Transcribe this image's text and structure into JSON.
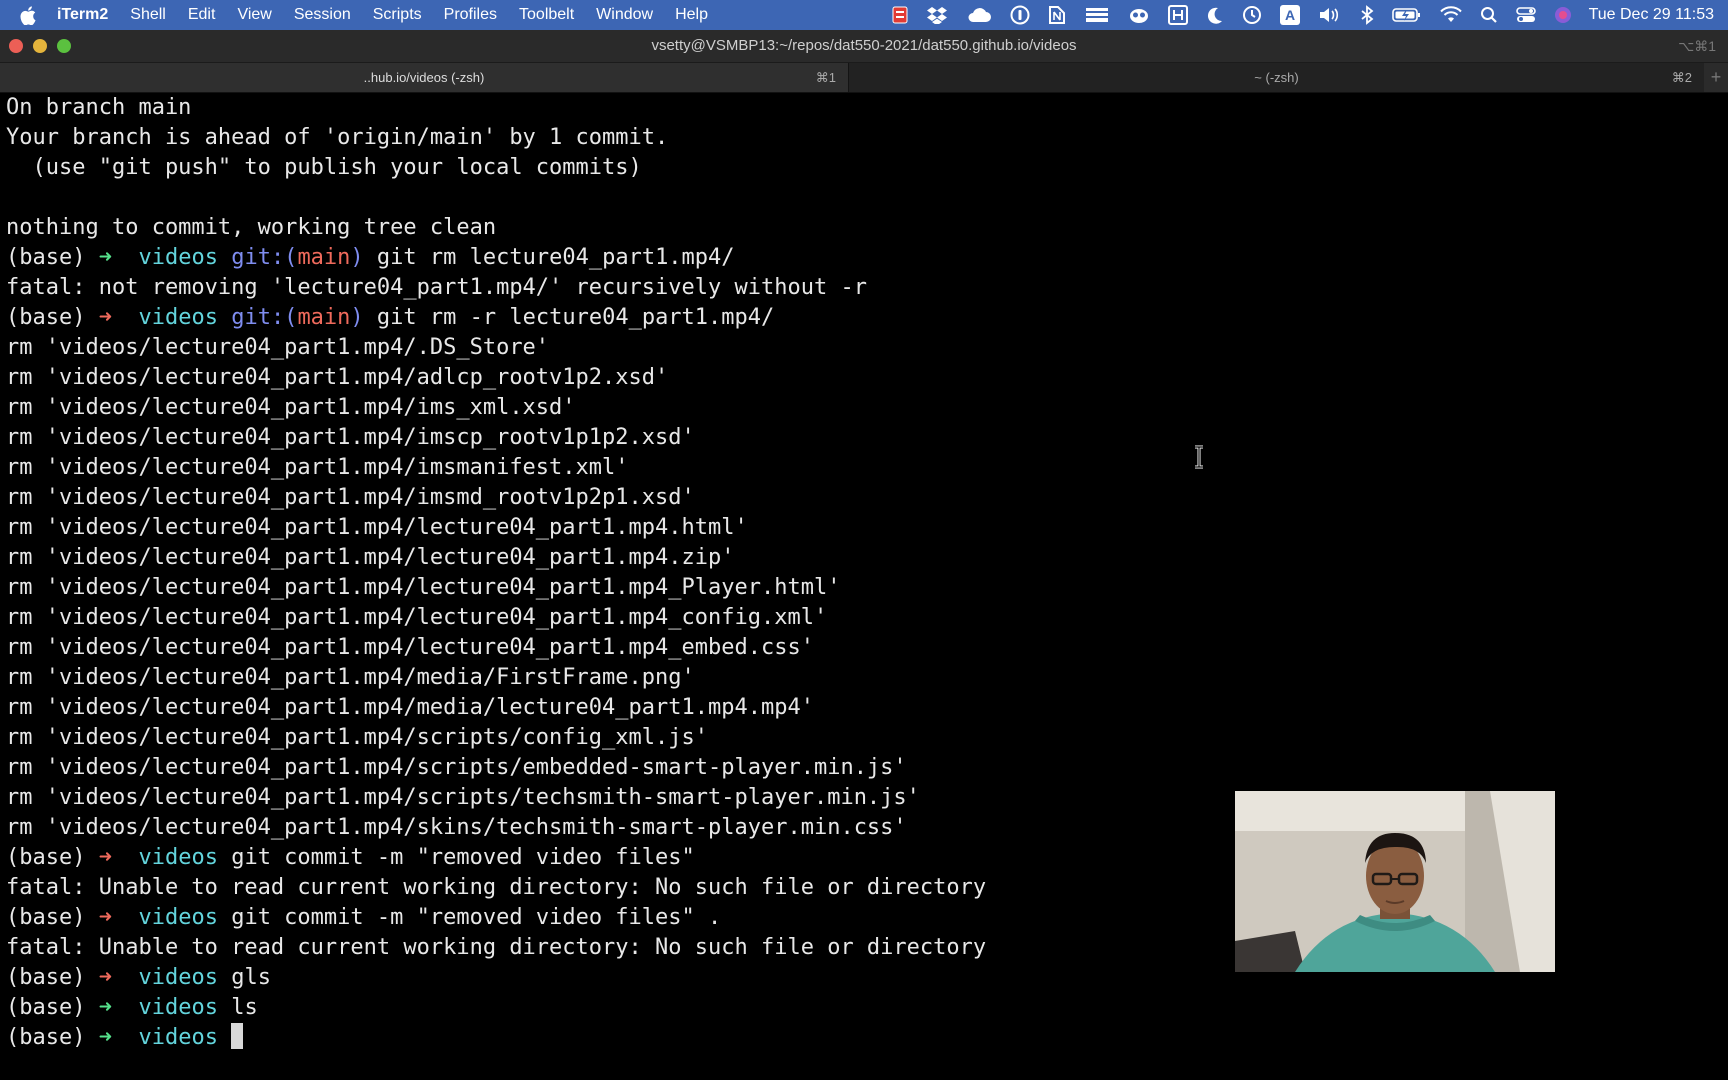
{
  "menubar": {
    "apple_icon": "apple-logo",
    "items": [
      "iTerm2",
      "Shell",
      "Edit",
      "View",
      "Session",
      "Scripts",
      "Profiles",
      "Toolbelt",
      "Window",
      "Help"
    ],
    "clock": "Tue Dec 29  11:53",
    "status_icons": [
      "recording-icon",
      "dropbox-icon",
      "cloud-icon",
      "onepassword-icon",
      "notion-icon",
      "stack-icon",
      "owl-icon",
      "keyboard-icon",
      "moon-icon",
      "time-machine-icon",
      "input-source-icon",
      "volume-icon",
      "bluetooth-icon",
      "battery-icon",
      "wifi-icon",
      "search-icon",
      "control-center-icon",
      "siri-icon"
    ],
    "input_source_label": "A",
    "colors": {
      "bar": "#3d66b4"
    }
  },
  "window": {
    "title": "vsetty@VSMBP13:~/repos/dat550-2021/dat550.github.io/videos",
    "shortcut": "⌥⌘1"
  },
  "tabs": [
    {
      "label": "..hub.io/videos (-zsh)",
      "shortcut": "⌘1"
    },
    {
      "label": "~ (-zsh)",
      "shortcut": "⌘2"
    }
  ],
  "new_tab_label": "+",
  "terminal": {
    "colors": {
      "cwd": "#63d4dc",
      "prompt_ok": "#55e08b",
      "prompt_err": "#ef6a5c",
      "git": "#7f8df0"
    },
    "lines": [
      [
        {
          "t": "On branch main"
        }
      ],
      [
        {
          "t": "Your branch is ahead of 'origin/main' by 1 commit."
        }
      ],
      [
        {
          "t": "  (use \"git push\" to publish your local commits)"
        }
      ],
      [
        {
          "t": ""
        }
      ],
      [
        {
          "t": "nothing to commit, working tree clean"
        }
      ],
      [
        {
          "t": "(base) "
        },
        {
          "t": "➜",
          "c": "green"
        },
        {
          "t": "  "
        },
        {
          "t": "videos",
          "c": "cyan"
        },
        {
          "t": " "
        },
        {
          "t": "git:(",
          "c": "blue"
        },
        {
          "t": "main",
          "c": "pink"
        },
        {
          "t": ")",
          "c": "blue"
        },
        {
          "t": " git rm lecture04_part1.mp4/"
        }
      ],
      [
        {
          "t": "fatal: not removing 'lecture04_part1.mp4/' recursively without -r"
        }
      ],
      [
        {
          "t": "(base) "
        },
        {
          "t": "➜",
          "c": "red"
        },
        {
          "t": "  "
        },
        {
          "t": "videos",
          "c": "cyan"
        },
        {
          "t": " "
        },
        {
          "t": "git:(",
          "c": "blue"
        },
        {
          "t": "main",
          "c": "pink"
        },
        {
          "t": ")",
          "c": "blue"
        },
        {
          "t": " git rm -r lecture04_part1.mp4/"
        }
      ],
      [
        {
          "t": "rm 'videos/lecture04_part1.mp4/.DS_Store'"
        }
      ],
      [
        {
          "t": "rm 'videos/lecture04_part1.mp4/adlcp_rootv1p2.xsd'"
        }
      ],
      [
        {
          "t": "rm 'videos/lecture04_part1.mp4/ims_xml.xsd'"
        }
      ],
      [
        {
          "t": "rm 'videos/lecture04_part1.mp4/imscp_rootv1p1p2.xsd'"
        }
      ],
      [
        {
          "t": "rm 'videos/lecture04_part1.mp4/imsmanifest.xml'"
        }
      ],
      [
        {
          "t": "rm 'videos/lecture04_part1.mp4/imsmd_rootv1p2p1.xsd'"
        }
      ],
      [
        {
          "t": "rm 'videos/lecture04_part1.mp4/lecture04_part1.mp4.html'"
        }
      ],
      [
        {
          "t": "rm 'videos/lecture04_part1.mp4/lecture04_part1.mp4.zip'"
        }
      ],
      [
        {
          "t": "rm 'videos/lecture04_part1.mp4/lecture04_part1.mp4_Player.html'"
        }
      ],
      [
        {
          "t": "rm 'videos/lecture04_part1.mp4/lecture04_part1.mp4_config.xml'"
        }
      ],
      [
        {
          "t": "rm 'videos/lecture04_part1.mp4/lecture04_part1.mp4_embed.css'"
        }
      ],
      [
        {
          "t": "rm 'videos/lecture04_part1.mp4/media/FirstFrame.png'"
        }
      ],
      [
        {
          "t": "rm 'videos/lecture04_part1.mp4/media/lecture04_part1.mp4.mp4'"
        }
      ],
      [
        {
          "t": "rm 'videos/lecture04_part1.mp4/scripts/config_xml.js'"
        }
      ],
      [
        {
          "t": "rm 'videos/lecture04_part1.mp4/scripts/embedded-smart-player.min.js'"
        }
      ],
      [
        {
          "t": "rm 'videos/lecture04_part1.mp4/scripts/techsmith-smart-player.min.js'"
        }
      ],
      [
        {
          "t": "rm 'videos/lecture04_part1.mp4/skins/techsmith-smart-player.min.css'"
        }
      ],
      [
        {
          "t": "(base) "
        },
        {
          "t": "➜",
          "c": "red"
        },
        {
          "t": "  "
        },
        {
          "t": "videos",
          "c": "cyan"
        },
        {
          "t": " git commit -m \"removed video files\""
        }
      ],
      [
        {
          "t": "fatal: Unable to read current working directory: No such file or directory"
        }
      ],
      [
        {
          "t": "(base) "
        },
        {
          "t": "➜",
          "c": "red"
        },
        {
          "t": "  "
        },
        {
          "t": "videos",
          "c": "cyan"
        },
        {
          "t": " git commit -m \"removed video files\" ."
        }
      ],
      [
        {
          "t": "fatal: Unable to read current working directory: No such file or directory"
        }
      ],
      [
        {
          "t": "(base) "
        },
        {
          "t": "➜",
          "c": "red"
        },
        {
          "t": "  "
        },
        {
          "t": "videos",
          "c": "cyan"
        },
        {
          "t": " gls"
        }
      ],
      [
        {
          "t": "(base) "
        },
        {
          "t": "➜",
          "c": "green"
        },
        {
          "t": "  "
        },
        {
          "t": "videos",
          "c": "cyan"
        },
        {
          "t": " ls"
        }
      ],
      [
        {
          "t": "(base) "
        },
        {
          "t": "➜",
          "c": "green"
        },
        {
          "t": "  "
        },
        {
          "t": "videos",
          "c": "cyan"
        },
        {
          "t": " "
        },
        {
          "cursor": true
        }
      ]
    ]
  },
  "webcam": {
    "icon": "webcam-person-overlay"
  }
}
